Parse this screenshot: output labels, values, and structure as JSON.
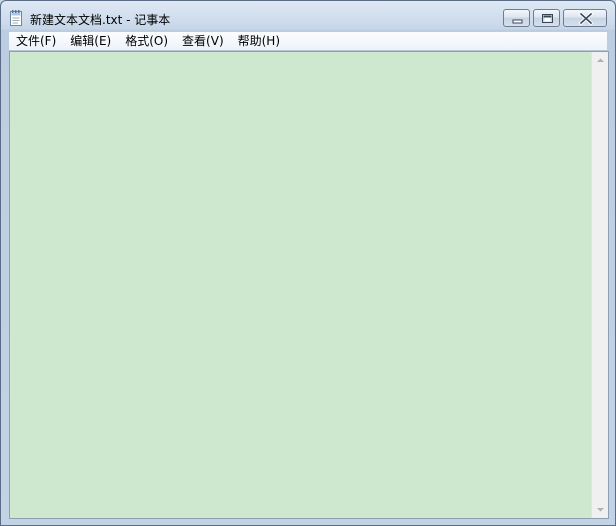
{
  "window": {
    "title": "新建文本文档.txt - 记事本",
    "icon": "notepad-icon",
    "controls": [
      "minimize-icon",
      "maximize-icon",
      "close-icon"
    ]
  },
  "menu": {
    "items": [
      {
        "label": "文件(F)"
      },
      {
        "label": "编辑(E)"
      },
      {
        "label": "格式(O)"
      },
      {
        "label": "查看(V)"
      },
      {
        "label": "帮助(H)"
      }
    ]
  },
  "editor": {
    "content": "",
    "background_color": "#cee8cf"
  },
  "scrollbar": {
    "up_icon": "scroll-up-arrow-icon",
    "down_icon": "scroll-down-arrow-icon"
  }
}
